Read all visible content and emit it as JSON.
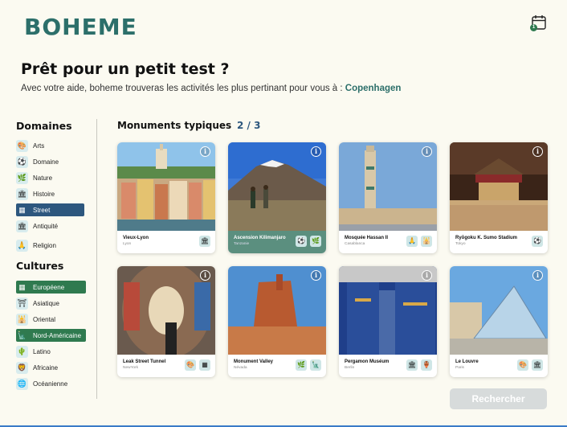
{
  "app": {
    "logo": "BOHEME"
  },
  "header": {
    "calendar_icon": "calendar-icon",
    "calendar_badge": "1"
  },
  "intro": {
    "title": "Prêt pour un petit test ?",
    "subtitle_prefix": "Avec votre aide, boheme trouveras les activités les plus pertinant pour vous à : ",
    "city": "Copenhagen"
  },
  "sidebar": {
    "domains_title": "Domaines",
    "domains": [
      {
        "label": "Arts",
        "icon": "🎨",
        "selected": false
      },
      {
        "label": "Domaine",
        "icon": "⚽",
        "selected": false
      },
      {
        "label": "Nature",
        "icon": "🌿",
        "selected": false
      },
      {
        "label": "Histoire",
        "icon": "🏛",
        "selected": false
      },
      {
        "label": "Street",
        "icon": "▦",
        "selected": true
      },
      {
        "label": "Antiquité",
        "icon": "🏛",
        "selected": false
      },
      {
        "label": "Religion",
        "icon": "🙏",
        "selected": false
      }
    ],
    "cultures_title": "Cultures",
    "cultures": [
      {
        "label": "Européene",
        "icon": "▦",
        "selected": true
      },
      {
        "label": "Asiatique",
        "icon": "⛩",
        "selected": false
      },
      {
        "label": "Oriental",
        "icon": "🕌",
        "selected": false
      },
      {
        "label": "Nord-Américaine",
        "icon": "🗽",
        "selected": true
      },
      {
        "label": "Latino",
        "icon": "🌵",
        "selected": false
      },
      {
        "label": "Africaine",
        "icon": "🦁",
        "selected": false
      },
      {
        "label": "Océanienne",
        "icon": "🌐",
        "selected": false
      }
    ]
  },
  "main": {
    "section_title": "Monuments typiques",
    "progress": "2 / 3",
    "cards": [
      {
        "name": "Vieux-Lyon",
        "city": "Lyon",
        "tags": [
          "🏛"
        ],
        "highlighted": false
      },
      {
        "name": "Ascension Kilimanjaro",
        "city": "Tanzanie",
        "tags": [
          "⚽",
          "🌿"
        ],
        "highlighted": true
      },
      {
        "name": "Mosquée Hassan II",
        "city": "Casablanca",
        "tags": [
          "🙏",
          "🕌"
        ],
        "highlighted": false
      },
      {
        "name": "Ryōgoku K. Sumo Stadium",
        "city": "Tokyo",
        "tags": [
          "⚽"
        ],
        "highlighted": false
      },
      {
        "name": "Leak Street Tunnel",
        "city": "NewYork",
        "tags": [
          "🎨",
          "▦"
        ],
        "highlighted": false
      },
      {
        "name": "Monument Valley",
        "city": "Névada",
        "tags": [
          "🌿",
          "🗽"
        ],
        "highlighted": false
      },
      {
        "name": "Pergamon Muséum",
        "city": "Berlin",
        "tags": [
          "🏛",
          "🏺"
        ],
        "highlighted": false
      },
      {
        "name": "Le Louvre",
        "city": "Paris",
        "tags": [
          "🎨",
          "🏛"
        ],
        "highlighted": false
      }
    ],
    "search_label": "Rechercher"
  },
  "colors": {
    "brand": "#2c6f6a",
    "selected_blue": "#2d577e",
    "selected_green": "#2f7a4f",
    "background": "#fbfaf1"
  }
}
